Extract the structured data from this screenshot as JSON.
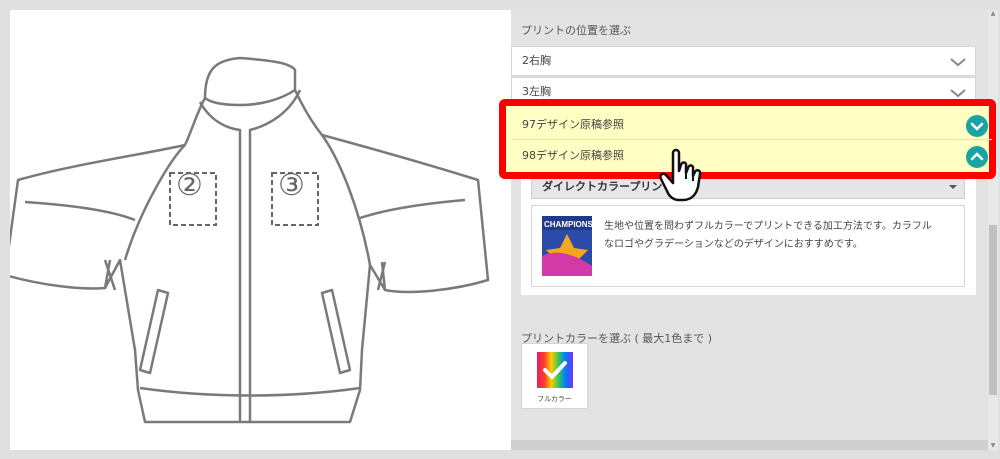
{
  "print_position": {
    "section_label": "プリントの位置を選ぶ",
    "options": [
      {
        "label": "2右胸"
      },
      {
        "label": "3左胸"
      },
      {
        "label": "97デザイン原稿参照"
      },
      {
        "label": "98デザイン原稿参照"
      }
    ]
  },
  "method_card": {
    "title": "ダイレクトカラープリント",
    "description_line1": "生地や位置を問わずフルカラーでプリントできる加工方法です。カラフル",
    "description_line2": "なロゴやグラデーションなどのデザインにおすすめです。",
    "thumb_text": "CHAMPIONS"
  },
  "print_color": {
    "section_label": "プリントカラーを選ぶ ( 最大1色まで )",
    "colors": [
      {
        "name": "フルカラー",
        "selected": true
      }
    ]
  },
  "jacket": {
    "markers": [
      "②",
      "③"
    ]
  },
  "colors": {
    "highlight_border": "#ff0000",
    "highlight_fill": "#ffffc4",
    "accent_teal": "#1aa3a3"
  },
  "icons": [
    "chevron-down-icon",
    "chevron-up-icon",
    "check-icon",
    "hand-pointer-icon"
  ]
}
